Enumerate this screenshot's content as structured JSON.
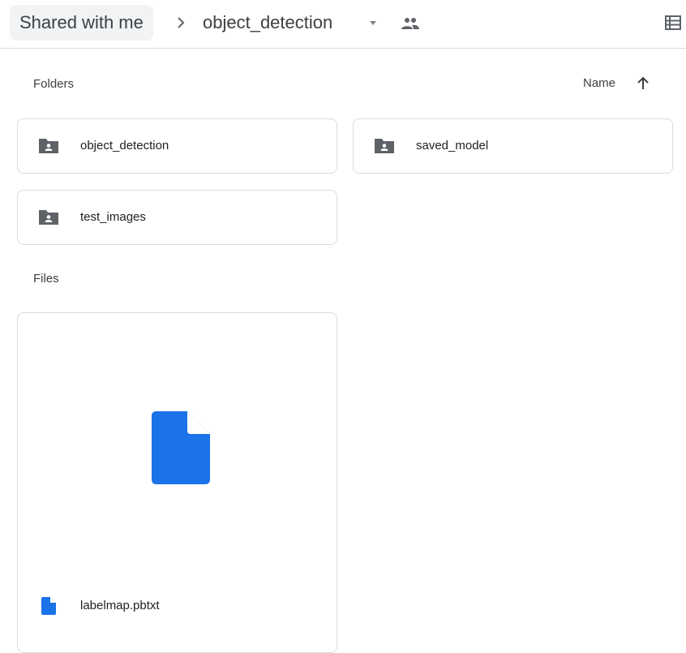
{
  "breadcrumb": {
    "root_label": "Shared with me",
    "separator_icon": "chevron-right-icon",
    "current_label": "object_detection",
    "caret_icon": "caret-down-icon",
    "shared_icon": "people-icon"
  },
  "toolbar": {
    "view_icon": "list-view-icon"
  },
  "sections": {
    "folders_label": "Folders",
    "files_label": "Files"
  },
  "sort": {
    "label": "Name",
    "direction_icon": "arrow-up-icon"
  },
  "folders": [
    {
      "name": "object_detection",
      "icon": "shared-folder-icon"
    },
    {
      "name": "saved_model",
      "icon": "shared-folder-icon"
    },
    {
      "name": "test_images",
      "icon": "shared-folder-icon"
    }
  ],
  "files": [
    {
      "name": "labelmap.pbtxt",
      "icon": "file-icon"
    }
  ],
  "colors": {
    "file_icon": "#1a73e8",
    "folder_icon": "#5f6368",
    "border": "#dadce0",
    "breadcrumb_bg": "#f1f3f4"
  }
}
